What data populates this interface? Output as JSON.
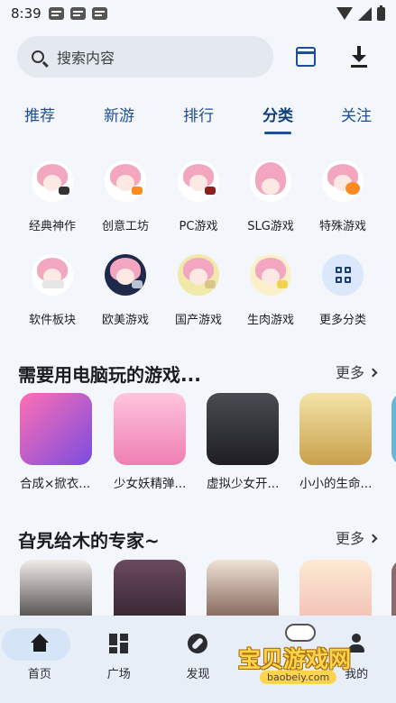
{
  "status_bar": {
    "time": "8:39",
    "notification_icons": [
      "message-icon",
      "message-icon",
      "message-icon"
    ]
  },
  "search": {
    "placeholder": "搜索内容",
    "icon": "search-icon"
  },
  "toolbar": {
    "calendar_icon": "calendar-icon",
    "download_icon": "download-icon"
  },
  "tabs": [
    {
      "label": "推荐",
      "active": false
    },
    {
      "label": "新游",
      "active": false
    },
    {
      "label": "排行",
      "active": false
    },
    {
      "label": "分类",
      "active": true
    },
    {
      "label": "关注",
      "active": false
    }
  ],
  "categories": [
    {
      "label": "经典神作",
      "prop_color": "#333333"
    },
    {
      "label": "创意工坊",
      "prop_color": "#ff8c1a"
    },
    {
      "label": "PC游戏",
      "prop_color": "#8b1e1e"
    },
    {
      "label": "SLG游戏",
      "prop_color": "#ffffff"
    },
    {
      "label": "特殊游戏",
      "prop_color": "#ff8a1f"
    },
    {
      "label": "软件板块",
      "prop_color": "#e6e6e6"
    },
    {
      "label": "欧美游戏",
      "prop_color": "#b8c4d6"
    },
    {
      "label": "国产游戏",
      "prop_color": "#d9c48a"
    },
    {
      "label": "生肉游戏",
      "prop_color": "#f2d24c"
    },
    {
      "label": "更多分类",
      "icon": "grid-icon"
    }
  ],
  "section1": {
    "title": "需要用电脑玩的游戏...",
    "more": "更多",
    "games": [
      {
        "title": "合成×掀衣...",
        "color": "#e84b9a"
      },
      {
        "title": "少女妖精弹...",
        "color": "#f4a3c8"
      },
      {
        "title": "虚拟少女开...",
        "color": "#3b3b40"
      },
      {
        "title": "小小的生命...",
        "color": "#d8b24d"
      },
      {
        "title": "",
        "color": "#6ab6d9"
      }
    ]
  },
  "section2": {
    "title": "旮旯给木的专家~",
    "more": "更多",
    "games": [
      {
        "color": "#2e2a2b"
      },
      {
        "color": "#4a2f3e"
      },
      {
        "color": "#6b4a3d"
      },
      {
        "color": "#f0b9b0"
      },
      {
        "color": "#8a6b6b"
      }
    ]
  },
  "bottom_nav": [
    {
      "label": "首页",
      "icon": "home-icon",
      "active": true
    },
    {
      "label": "广场",
      "icon": "dashboard-icon",
      "active": false
    },
    {
      "label": "发现",
      "icon": "compass-icon",
      "active": false
    },
    {
      "label": "",
      "icon": "",
      "active": false
    },
    {
      "label": "我的",
      "icon": "person-icon",
      "active": false
    }
  ],
  "watermark": {
    "text": "宝贝游戏网",
    "url": "baobeiy.com"
  }
}
